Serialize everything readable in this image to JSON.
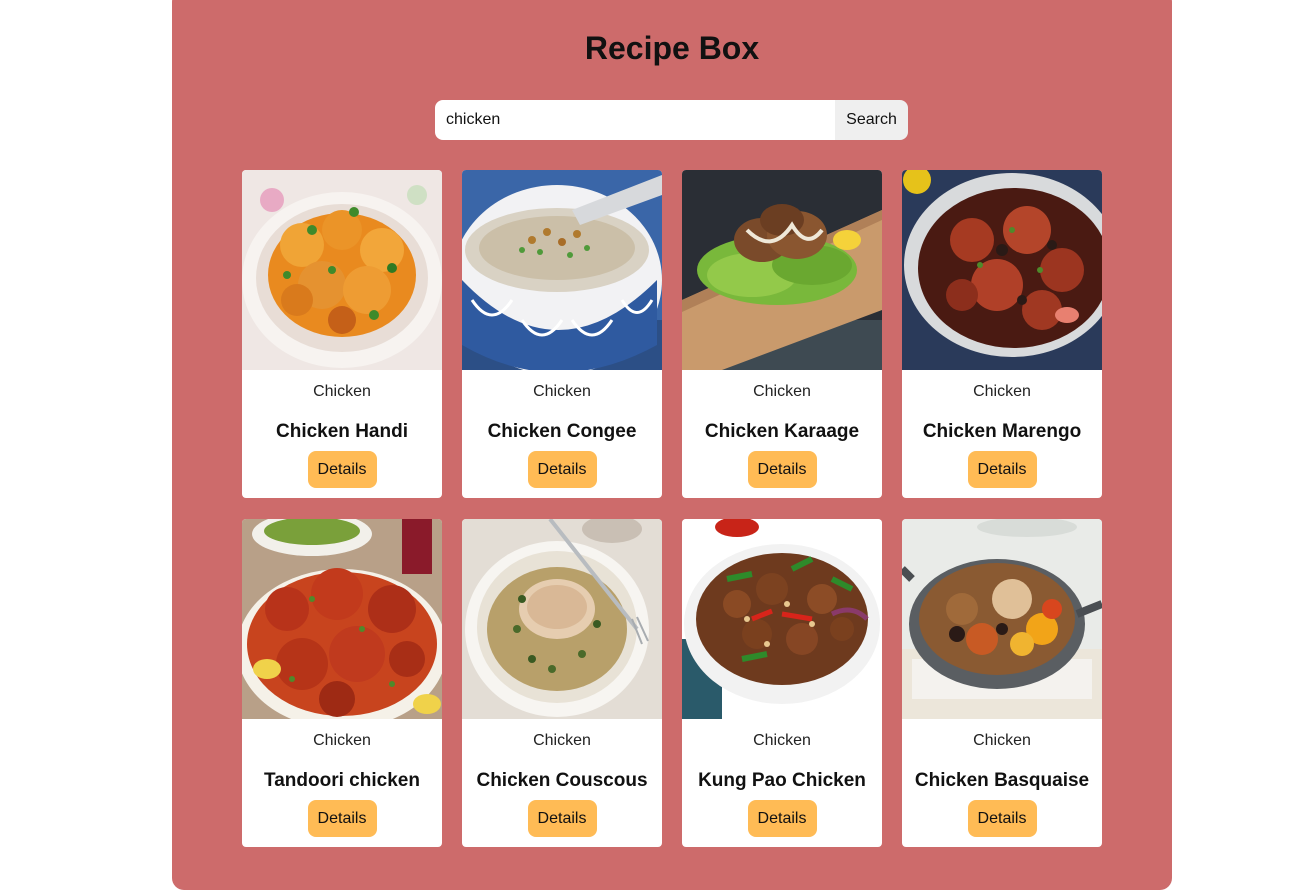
{
  "app": {
    "title": "Recipe Box"
  },
  "search": {
    "value": "chicken",
    "button_label": "Search"
  },
  "colors": {
    "panel": "#cd6b6b",
    "details_button": "#ffbb55",
    "search_button": "#efefef"
  },
  "recipes": [
    {
      "category": "Chicken",
      "name": "Chicken Handi",
      "button": "Details",
      "image": "bowl of orange curried chicken pieces with cilantro"
    },
    {
      "category": "Chicken",
      "name": "Chicken Congee",
      "button": "Details",
      "image": "rice porridge in blue patterned bowl with green onions"
    },
    {
      "category": "Chicken",
      "name": "Chicken Karaage",
      "button": "Details",
      "image": "fried chicken on lettuce on wooden board"
    },
    {
      "category": "Chicken",
      "name": "Chicken Marengo",
      "button": "Details",
      "image": "chicken stew in white pot"
    },
    {
      "category": "Chicken",
      "name": "Tandoori chicken",
      "button": "Details",
      "image": "red tandoori chicken pieces with green chutney"
    },
    {
      "category": "Chicken",
      "name": "Chicken Couscous",
      "button": "Details",
      "image": "chicken on couscous in white bowl"
    },
    {
      "category": "Chicken",
      "name": "Kung Pao Chicken",
      "button": "Details",
      "image": "stir fried chicken with peppers and peanuts"
    },
    {
      "category": "Chicken",
      "name": "Chicken Basquaise",
      "button": "Details",
      "image": "chicken with peppers in grey pan"
    }
  ]
}
